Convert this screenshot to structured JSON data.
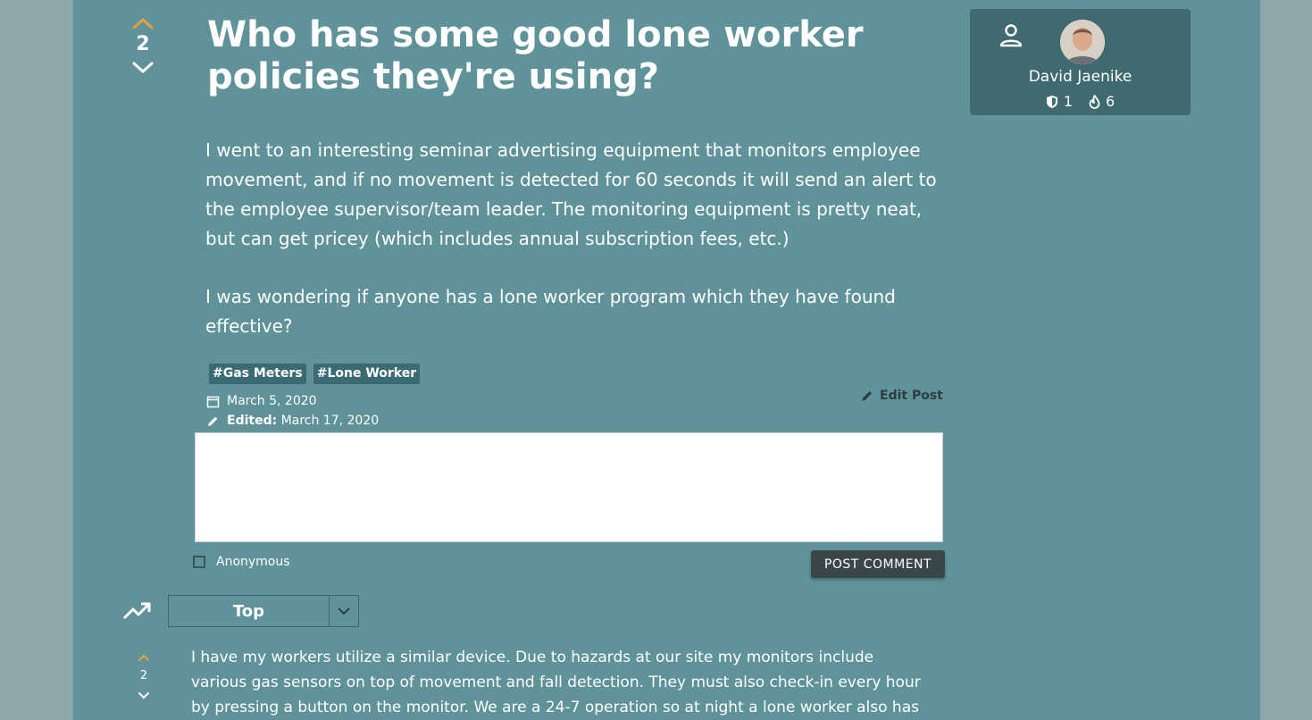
{
  "post": {
    "votes": "2",
    "title": "Who has some good lone worker policies they're using?",
    "body": [
      "I went to an interesting seminar advertising equipment that monitors employee movement, and if no movement is detected for 60 seconds it will send an alert to the employee supervisor/team leader. The monitoring equipment is pretty neat, but can get pricey (which includes annual subscription fees, etc.)",
      "I was wondering if anyone has a lone worker program which they have found effective?"
    ],
    "tags": [
      "#Gas Meters",
      "#Lone Worker"
    ],
    "date": "March 5, 2020",
    "edited_label": "Edited:",
    "edited_date": "March 17, 2020",
    "edit_post_label": "Edit Post"
  },
  "comment_form": {
    "anonymous_label": "Anonymous",
    "submit_label": "POST COMMENT"
  },
  "sort": {
    "selected": "Top"
  },
  "comments": [
    {
      "votes": "2",
      "text": "I have my workers utilize a similar device. Due to hazards at our site my monitors include various gas sensors on top of movement and fall detection. They must also check-in every hour by pressing a button on the monitor. We are a 24-7 operation so at night a lone worker also has"
    }
  ],
  "author": {
    "name": "David Jaenike",
    "badge_count": "1",
    "streak_count": "6"
  },
  "colors": {
    "page_bg": "#5f9299",
    "outer_bg": "#8ea5aa",
    "upvote_accent": "#e8a23c",
    "card_bg": "#3e6a70",
    "tag_bg": "#3b6b72",
    "button_bg": "#3a4648"
  },
  "icons": {
    "upvote": "chevron-up-icon",
    "downvote": "chevron-down-icon",
    "date": "calendar-icon",
    "edited": "pencil-icon",
    "sort": "trending-up-icon",
    "author": "person-icon",
    "badge": "shield-icon",
    "streak": "flame-icon"
  }
}
